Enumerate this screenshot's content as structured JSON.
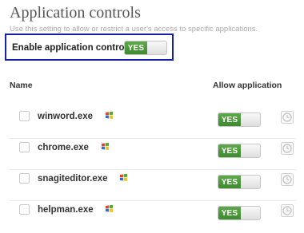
{
  "header": {
    "title": "Application controls",
    "subtitle": "Use this setting to allow or restrict a user's access to specific applications."
  },
  "enable": {
    "label": "Enable application controls",
    "toggle_label": "YES",
    "enabled": true
  },
  "columns": {
    "name": "Name",
    "allow": "Allow application"
  },
  "apps": [
    {
      "name": "winword.exe",
      "allow_label": "YES",
      "icon": "windows-flag-icon"
    },
    {
      "name": "chrome.exe",
      "allow_label": "YES",
      "icon": "windows-flag-icon"
    },
    {
      "name": "snagiteditor.exe",
      "allow_label": "YES",
      "icon": "windows-flag-icon"
    },
    {
      "name": "helpman.exe",
      "allow_label": "YES",
      "icon": "windows-flag-icon"
    }
  ],
  "colors": {
    "accent_green": "#4a9a39",
    "focus_border": "#1520a6"
  }
}
